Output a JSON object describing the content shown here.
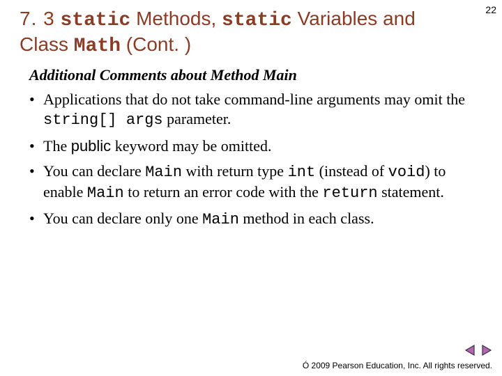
{
  "page_number": "22",
  "title": {
    "section": "7. 3",
    "code1": "static",
    "word1": "Methods,",
    "code2": "static",
    "word2": "Variables",
    "word3": "and Class",
    "code3": "Math",
    "cont": "(Cont. )"
  },
  "subheading": "Additional Comments about Method Main",
  "bullets": [
    {
      "p1": "Applications that do not take command-line arguments may omit the ",
      "code1": "string[] args",
      "p2": " parameter."
    },
    {
      "p1": "The ",
      "code1": "public",
      "p2": " keyword may be omitted."
    },
    {
      "p1": "You can declare ",
      "code1": "Main",
      "p2": " with return type ",
      "code2": "int",
      "p3": " (instead of ",
      "code3": "void",
      "p4": ") to enable ",
      "code4": "Main",
      "p5": " to return an error code with the ",
      "code5": "return",
      "p6": " statement."
    },
    {
      "p1": "You can declare only one ",
      "code1": "Main",
      "p2": " method in each class."
    }
  ],
  "footer": {
    "symbol": "Ó",
    "text": "2009 Pearson Education, Inc. All rights reserved."
  },
  "colors": {
    "title": "#8A3C24",
    "nav_fill": "#B069A8",
    "nav_stroke": "#3E2A55"
  }
}
